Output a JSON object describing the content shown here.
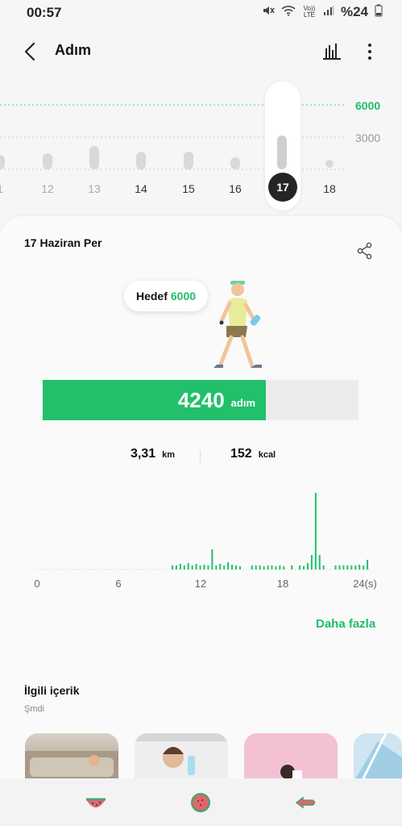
{
  "status": {
    "time": "00:57",
    "battery": "%24",
    "network": "Vo)) LTE"
  },
  "header": {
    "title": "Adım"
  },
  "week_chart": {
    "goal_label": "6000",
    "mid_label": "3000",
    "days": [
      {
        "label": "1",
        "steps": 1800
      },
      {
        "label": "12",
        "steps": 2000
      },
      {
        "label": "13",
        "steps": 2900
      },
      {
        "label": "14",
        "steps": 2200
      },
      {
        "label": "15",
        "steps": 2200
      },
      {
        "label": "16",
        "steps": 1500
      },
      {
        "label": "17",
        "steps": 4240,
        "selected": true
      },
      {
        "label": "18",
        "steps": 0
      }
    ]
  },
  "summary": {
    "date": "17 Haziran Per",
    "goal_text": "Hedef",
    "goal_value": "6000",
    "steps_value": "4240",
    "steps_unit": "adım",
    "progress": 0.7067,
    "distance_value": "3,31",
    "distance_unit": "km",
    "calories_value": "152",
    "calories_unit": "kcal"
  },
  "hour_chart": {
    "axis_labels": [
      "0",
      "6",
      "12",
      "18",
      "24(s)"
    ],
    "bars": [
      0,
      0,
      0,
      0,
      0,
      0,
      0,
      0,
      0,
      0,
      0,
      0,
      0,
      0,
      0,
      0,
      0,
      0,
      0,
      0,
      0,
      0,
      0,
      0,
      0,
      0,
      0,
      0,
      0,
      0,
      0,
      0,
      0,
      0,
      5,
      5,
      7,
      5,
      8,
      5,
      7,
      5,
      6,
      5,
      25,
      5,
      7,
      5,
      9,
      6,
      5,
      4,
      0,
      0,
      5,
      5,
      5,
      4,
      5,
      5,
      4,
      5,
      4,
      0,
      5,
      0,
      5,
      4,
      8,
      18,
      95,
      18,
      5,
      0,
      0,
      5,
      5,
      5,
      5,
      5,
      5,
      6,
      5,
      12,
      0
    ]
  },
  "more_label": "Daha fazla",
  "related": {
    "title": "İlgili içerik",
    "subtitle": "Şmdi"
  },
  "colors": {
    "accent": "#1fbd6a"
  }
}
